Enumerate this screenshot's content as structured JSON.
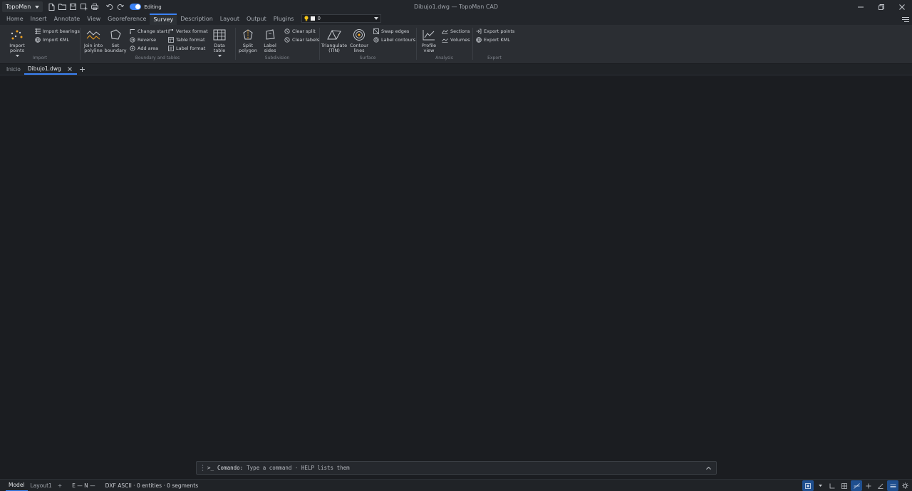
{
  "app": {
    "menu_label": "TopoMan",
    "window_title": "Dibujo1.dwg — TopoMan CAD",
    "editing_label": "Editing",
    "quick_tools": [
      "new-file-icon",
      "open-folder-icon",
      "save-icon",
      "save-all-icon",
      "print-icon",
      "undo-icon",
      "redo-icon"
    ]
  },
  "ribbon_tabs": [
    {
      "label": "Home"
    },
    {
      "label": "Insert"
    },
    {
      "label": "Annotate"
    },
    {
      "label": "View"
    },
    {
      "label": "Georeference"
    },
    {
      "label": "Survey",
      "active": true
    },
    {
      "label": "Description"
    },
    {
      "label": "Layout"
    },
    {
      "label": "Output"
    },
    {
      "label": "Plugins"
    }
  ],
  "layer": {
    "current": "0",
    "color": "#f2f2f2",
    "bulb_color": "#f5c518"
  },
  "ribbon": {
    "import": {
      "label": "Import",
      "import_points": "Import points",
      "import_bearings": "Import bearings",
      "import_kml": "Import KML"
    },
    "boundary": {
      "label": "Boundary and tables",
      "join_line1": "Join into",
      "join_line2": "polyline",
      "set_line1": "Set",
      "set_line2": "boundary",
      "change_start": "Change start",
      "reverse": "Reverse",
      "add_area": "Add area",
      "vertex_format": "Vertex format",
      "table_format": "Table format",
      "label_format": "Label format",
      "data_table": "Data table"
    },
    "subdivision": {
      "label": "Subdivision",
      "split_line1": "Split",
      "split_line2": "polygon",
      "label_line1": "Label",
      "label_line2": "sides",
      "clear_split": "Clear split",
      "clear_labels": "Clear labels"
    },
    "surface": {
      "label": "Surface",
      "tin_line1": "Triangulate",
      "tin_line2": "(TIN)",
      "contour_line1": "Contour",
      "contour_line2": "lines",
      "swap_edges": "Swap edges",
      "label_contours": "Label contours"
    },
    "analysis": {
      "label": "Analysis",
      "profile_line1": "Profile",
      "profile_line2": "view",
      "sections": "Sections",
      "volumes": "Volumes"
    },
    "export": {
      "label": "Export",
      "export_points": "Export points",
      "export_kml": "Export KML"
    }
  },
  "doc_tabs": [
    {
      "label": "Inicio"
    },
    {
      "label": "Dibujo1.dwg",
      "active": true,
      "closable": true
    }
  ],
  "command": {
    "prompt": ">_",
    "label": "Comando:",
    "placeholder": "Type a command · HELP lists them"
  },
  "status": {
    "layout_tabs": [
      {
        "label": "Model",
        "active": true
      },
      {
        "label": "Layout1"
      }
    ],
    "add_layout": "+",
    "coords": "E — N —",
    "drawing_info": "DXF ASCII · 0 entities · 0 segments"
  },
  "colors": {
    "accent": "#3b82f6",
    "icon": "#c8ccd2",
    "icon_accent": "#f0a020"
  }
}
